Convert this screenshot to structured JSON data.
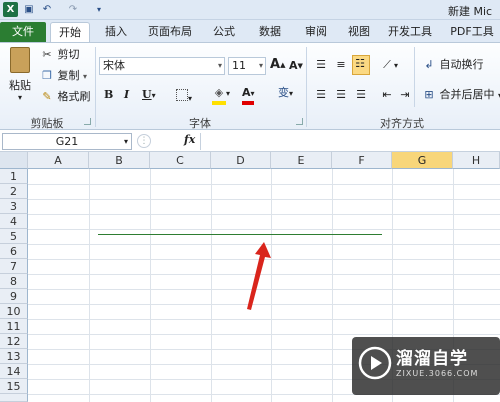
{
  "window": {
    "title": "新建 Mic"
  },
  "tabs": [
    "文件",
    "开始",
    "插入",
    "页面布局",
    "公式",
    "数据",
    "审阅",
    "视图",
    "开发工具",
    "PDF工具"
  ],
  "clipboard": {
    "paste": "粘贴",
    "cut": "剪切",
    "copy": "复制",
    "format_painter": "格式刷",
    "label": "剪贴板"
  },
  "font": {
    "name": "宋体",
    "size": "11",
    "bold": "B",
    "italic": "I",
    "underline": "U",
    "grow": "A",
    "shrink": "A",
    "color_letter": "A",
    "phonetic": "变",
    "label": "字体"
  },
  "alignment": {
    "wrap": "自动换行",
    "merge": "合并后居中",
    "label": "对齐方式"
  },
  "formula_bar": {
    "cell": "G21",
    "fx": "fx"
  },
  "columns": [
    "A",
    "B",
    "C",
    "D",
    "E",
    "F",
    "G",
    "H"
  ],
  "rows": [
    "1",
    "2",
    "3",
    "4",
    "5",
    "6",
    "7",
    "8",
    "9",
    "10",
    "11",
    "12",
    "13",
    "14",
    "15"
  ],
  "watermark": {
    "brand": "溜溜自学",
    "url": "ZIXUE.3066.COM"
  },
  "colors": {
    "selected_column": "#f8d67a",
    "line": "#2e7d32",
    "arrow": "#d9251c"
  }
}
